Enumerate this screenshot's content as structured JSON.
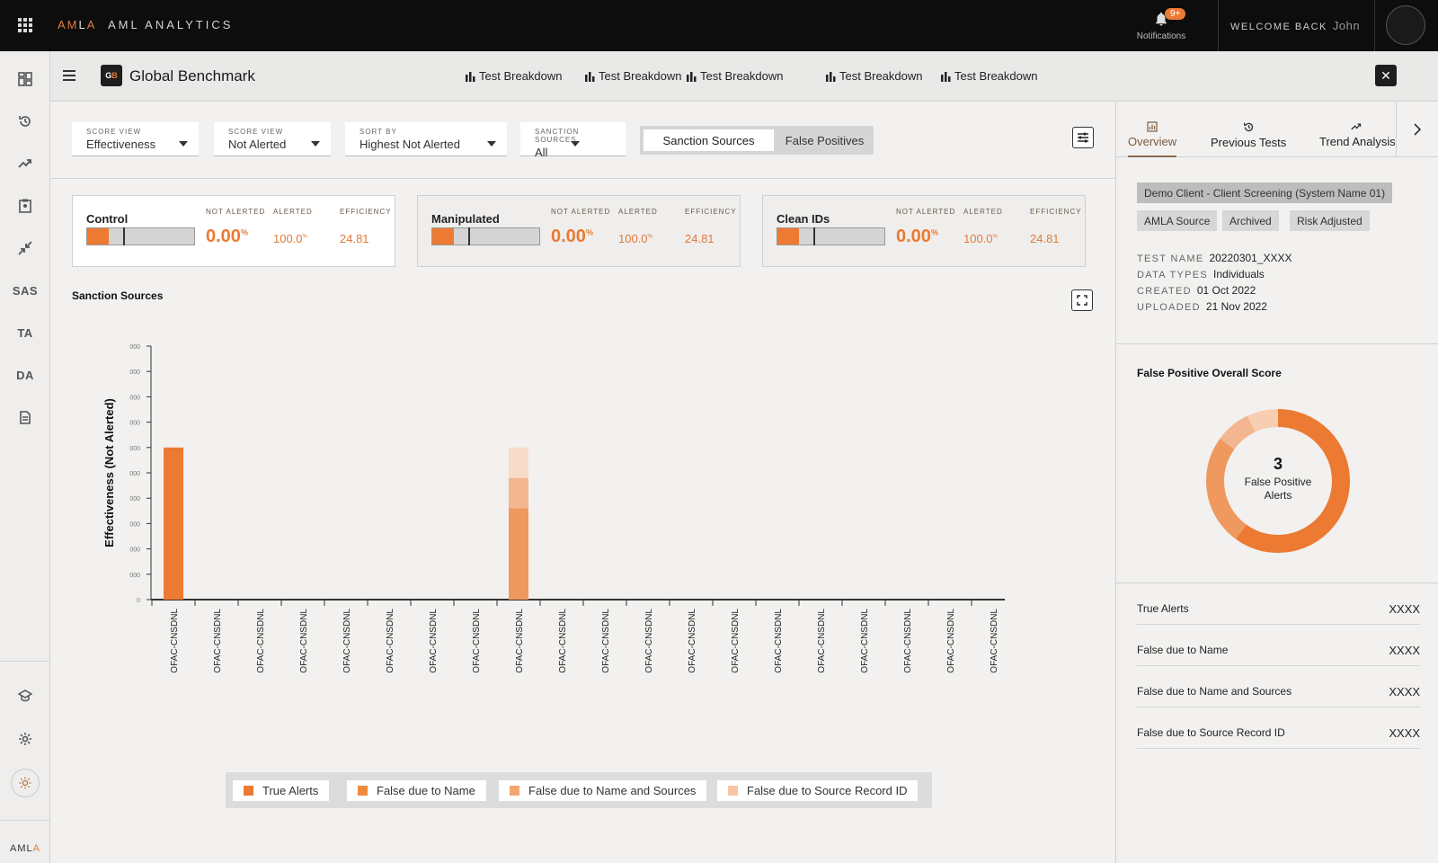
{
  "topbar": {
    "logo": "AMLA",
    "app_title": "AML ANALYTICS",
    "notifications_label": "Notifications",
    "notifications_badge": "9+",
    "welcome_label": "WELCOME BACK",
    "user_name": "John"
  },
  "leftnav": {
    "items": [
      {
        "icon": "dashboard-icon"
      },
      {
        "icon": "history-icon"
      },
      {
        "icon": "trend-icon"
      },
      {
        "icon": "clipboard-icon"
      },
      {
        "icon": "collapse-icon"
      },
      {
        "label": "SAS"
      },
      {
        "label": "TA"
      },
      {
        "label": "DA"
      },
      {
        "icon": "document-icon"
      }
    ],
    "bottom": [
      {
        "icon": "education-icon"
      },
      {
        "icon": "settings-icon"
      },
      {
        "icon": "theme-icon"
      }
    ],
    "brand": "AMLA"
  },
  "header": {
    "badge": "GB",
    "title": "Global Benchmark",
    "tabs": [
      "Test Breakdown",
      "Test Breakdown",
      "Test Breakdown",
      "Test Breakdown",
      "Test Breakdown"
    ]
  },
  "filters": {
    "score_view_1": {
      "caption": "SCORE VIEW",
      "value": "Effectiveness"
    },
    "score_view_2": {
      "caption": "SCORE VIEW",
      "value": "Not Alerted"
    },
    "sort_by": {
      "caption": "SORT BY",
      "value": "Highest Not Alerted"
    },
    "sanction_sources": {
      "caption": "SANCTION SOURCES",
      "value": "All"
    },
    "toggle": {
      "active": "Sanction Sources",
      "inactive": "False Positives"
    }
  },
  "cards": [
    {
      "name": "Control",
      "h_not_alerted": "NOT ALERTED",
      "h_alerted": "ALERTED",
      "h_efficiency": "EFFICIENCY",
      "not_alerted": "0.00",
      "not_alerted_unit": "%",
      "alerted": "100.0",
      "alerted_unit": "%",
      "efficiency": "24.81"
    },
    {
      "name": "Manipulated",
      "h_not_alerted": "NOT ALERTED",
      "h_alerted": "ALERTED",
      "h_efficiency": "EFFICIENCY",
      "not_alerted": "0.00",
      "not_alerted_unit": "%",
      "alerted": "100.0",
      "alerted_unit": "%",
      "efficiency": "24.81"
    },
    {
      "name": "Clean IDs",
      "h_not_alerted": "NOT ALERTED",
      "h_alerted": "ALERTED",
      "h_efficiency": "EFFICIENCY",
      "not_alerted": "0.00",
      "not_alerted_unit": "%",
      "alerted": "100.0",
      "alerted_unit": "%",
      "efficiency": "24.81"
    }
  ],
  "chart_section": {
    "title": "Sanction Sources"
  },
  "chart_data": {
    "type": "bar",
    "stacked": true,
    "ylabel": "Effectiveness (Not Alerted)",
    "ytick_labels": [
      "0",
      "000",
      "000",
      "000",
      "000",
      "000",
      "000",
      "000",
      "000",
      "000",
      "000"
    ],
    "categories": [
      "OFAC-CNSDNL",
      "OFAC-CNSDNL",
      "OFAC-CNSDNL",
      "OFAC-CNSDNL",
      "OFAC-CNSDNL",
      "OFAC-CNSDNL",
      "OFAC-CNSDNL",
      "OFAC-CNSDNL",
      "OFAC-CNSDNL",
      "OFAC-CNSDNL",
      "OFAC-CNSDNL",
      "OFAC-CNSDNL",
      "OFAC-CNSDNL",
      "OFAC-CNSDNL",
      "OFAC-CNSDNL",
      "OFAC-CNSDNL",
      "OFAC-CNSDNL",
      "OFAC-CNSDNL",
      "OFAC-CNSDNL",
      "OFAC-CNSDNL"
    ],
    "ylim": [
      0,
      10
    ],
    "series": [
      {
        "name": "True Alerts",
        "color": "#ec7a32",
        "values": [
          6,
          0,
          0,
          0,
          0,
          0,
          0,
          0,
          0,
          0,
          0,
          0,
          0,
          0,
          0,
          0,
          0,
          0,
          0,
          0
        ]
      },
      {
        "name": "False due to Name",
        "color": "#f0995e",
        "values": [
          0,
          0,
          0,
          0,
          0,
          0,
          0,
          0,
          3.6,
          0,
          0,
          0,
          0,
          0,
          0,
          0,
          0,
          0,
          0,
          0
        ]
      },
      {
        "name": "False due to Name and Sources",
        "color": "#f3b690",
        "values": [
          0,
          0,
          0,
          0,
          0,
          0,
          0,
          0,
          1.2,
          0,
          0,
          0,
          0,
          0,
          0,
          0,
          0,
          0,
          0,
          0
        ]
      },
      {
        "name": "False due to Source Record ID",
        "color": "#f8dcc9",
        "values": [
          0,
          0,
          0,
          0,
          0,
          0,
          0,
          0,
          1.2,
          0,
          0,
          0,
          0,
          0,
          0,
          0,
          0,
          0,
          0,
          0
        ]
      }
    ],
    "legend": [
      "True Alerts",
      "False due to Name",
      "False due to Name and Sources",
      "False due to Source Record ID"
    ],
    "legend_colors": [
      "#ec7a32",
      "#f08a3e",
      "#f3a672",
      "#f8c6a4"
    ]
  },
  "right_panel": {
    "tabs": [
      "Overview",
      "Previous Tests",
      "Trend Analysis"
    ],
    "active_tab": "Overview",
    "client_chip": "Demo Client - Client Screening (System Name 01)",
    "tags": [
      "AMLA Source",
      "Archived",
      "Risk Adjusted"
    ],
    "meta": [
      {
        "key": "TEST NAME",
        "value": "20220301_XXXX"
      },
      {
        "key": "DATA TYPES",
        "value": "Individuals"
      },
      {
        "key": "CREATED",
        "value": "01 Oct 2022"
      },
      {
        "key": "UPLOADED",
        "value": "21 Nov 2022"
      }
    ],
    "fp_title": "False Positive Overall Score",
    "donut": {
      "count": "3",
      "label": "False Positive Alerts",
      "segments": [
        {
          "name": "True Alerts",
          "fraction": 0.6,
          "color": "#ec7a32"
        },
        {
          "name": "False due to Name",
          "fraction": 0.25,
          "color": "#f0995e"
        },
        {
          "name": "False due to Name and Sources",
          "fraction": 0.08,
          "color": "#f3b690"
        },
        {
          "name": "False due to Source Record ID",
          "fraction": 0.07,
          "color": "#f8ceb3"
        }
      ]
    },
    "stats": [
      {
        "label": "True Alerts",
        "value": "XXXX"
      },
      {
        "label": "False due to Name",
        "value": "XXXX"
      },
      {
        "label": "False due to Name and Sources",
        "value": "XXXX"
      },
      {
        "label": "False due to Source Record ID",
        "value": "XXXX"
      }
    ]
  }
}
